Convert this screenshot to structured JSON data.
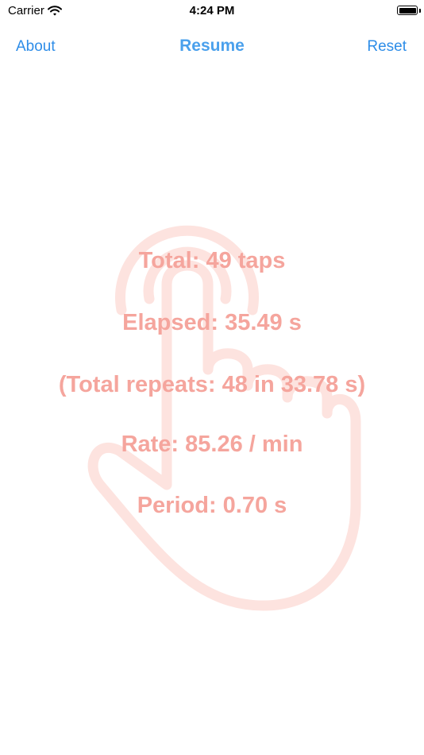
{
  "status_bar": {
    "carrier": "Carrier",
    "time": "4:24 PM"
  },
  "nav": {
    "left_label": "About",
    "title": "Resume",
    "right_label": "Reset"
  },
  "stats": {
    "total": "Total: 49 taps",
    "elapsed": "Elapsed: 35.49 s",
    "repeats": "(Total repeats: 48 in 33.78 s)",
    "rate": "Rate: 85.26 / min",
    "period": "Period: 0.70 s"
  },
  "colors": {
    "accent": "#2e8de8",
    "stats_text": "#f5a59d",
    "hand_outline": "#fde3df"
  },
  "icons": {
    "background": "tap-hand-icon",
    "wifi": "wifi-icon",
    "battery": "battery-icon"
  }
}
